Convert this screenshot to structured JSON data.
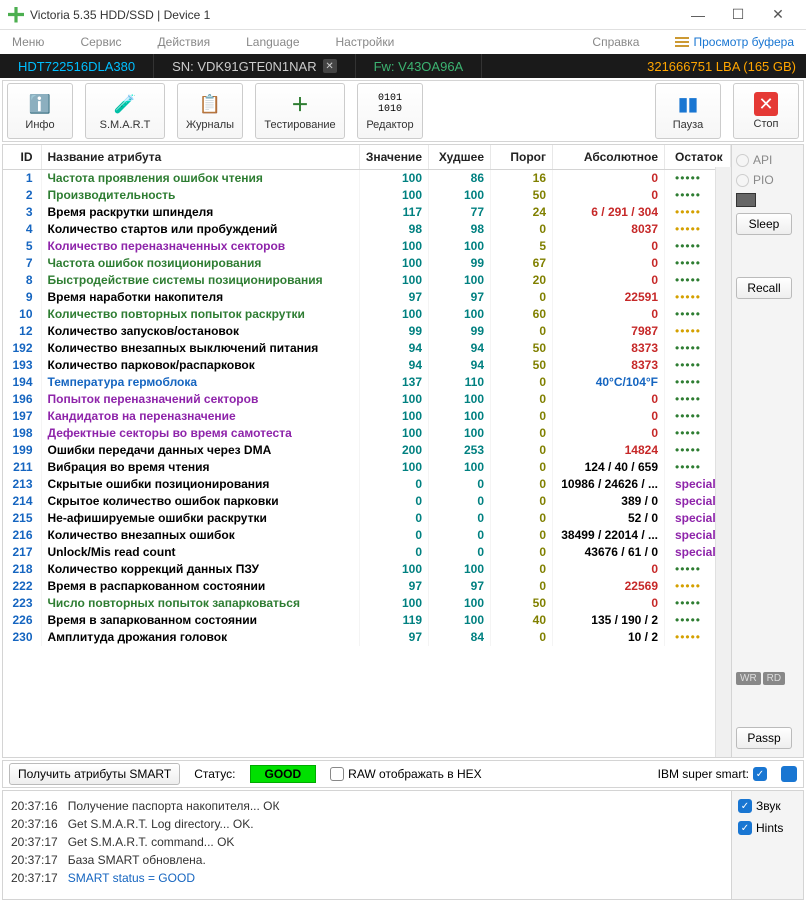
{
  "window": {
    "title": "Victoria 5.35 HDD/SSD | Device 1"
  },
  "menu": {
    "items": [
      "Меню",
      "Сервис",
      "Действия",
      "Language",
      "Настройки"
    ],
    "help": "Справка",
    "buffer": "Просмотр буфера"
  },
  "device": {
    "model": "HDT722516DLA380",
    "sn_label": "SN:",
    "sn": "VDK91GTE0N1NAR",
    "fw_label": "Fw:",
    "fw": "V43OA96A",
    "lba": "321666751 LBA (165 GB)"
  },
  "toolbar": {
    "info": "Инфо",
    "smart": "S.M.A.R.T",
    "journals": "Журналы",
    "testing": "Тестирование",
    "editor": "Редактор",
    "pause": "Пауза",
    "stop": "Стоп"
  },
  "headers": {
    "id": "ID",
    "name": "Название атрибута",
    "value": "Значение",
    "worst": "Худшее",
    "threshold": "Порог",
    "absolute": "Абсолютное",
    "rest": "Остаток"
  },
  "rows": [
    {
      "id": "1",
      "name": "Частота проявления ошибок чтения",
      "nc": "green",
      "val": "100",
      "worst": "86",
      "th": "16",
      "abs": "0",
      "ac": "red",
      "rest": "•••••",
      "rc": "green"
    },
    {
      "id": "2",
      "name": "Производительность",
      "nc": "green",
      "val": "100",
      "worst": "100",
      "th": "50",
      "abs": "0",
      "ac": "red",
      "rest": "•••••",
      "rc": "green"
    },
    {
      "id": "3",
      "name": "Время раскрутки шпинделя",
      "nc": "black",
      "val": "117",
      "worst": "77",
      "th": "24",
      "abs": "6 / 291 / 304",
      "ac": "red",
      "rest": "•••••",
      "rc": "yellow"
    },
    {
      "id": "4",
      "name": "Количество стартов или пробуждений",
      "nc": "black",
      "val": "98",
      "worst": "98",
      "th": "0",
      "abs": "8037",
      "ac": "red",
      "rest": "•••••",
      "rc": "yellow"
    },
    {
      "id": "5",
      "name": "Количество переназначенных секторов",
      "nc": "purple",
      "val": "100",
      "worst": "100",
      "th": "5",
      "abs": "0",
      "ac": "red",
      "rest": "•••••",
      "rc": "green"
    },
    {
      "id": "7",
      "name": "Частота ошибок позиционирования",
      "nc": "green",
      "val": "100",
      "worst": "99",
      "th": "67",
      "abs": "0",
      "ac": "red",
      "rest": "•••••",
      "rc": "green"
    },
    {
      "id": "8",
      "name": "Быстродействие системы позиционирования",
      "nc": "green",
      "val": "100",
      "worst": "100",
      "th": "20",
      "abs": "0",
      "ac": "red",
      "rest": "•••••",
      "rc": "green"
    },
    {
      "id": "9",
      "name": "Время наработки накопителя",
      "nc": "black",
      "val": "97",
      "worst": "97",
      "th": "0",
      "abs": "22591",
      "ac": "red",
      "rest": "•••••",
      "rc": "yellow"
    },
    {
      "id": "10",
      "name": "Количество повторных попыток раскрутки",
      "nc": "green",
      "val": "100",
      "worst": "100",
      "th": "60",
      "abs": "0",
      "ac": "red",
      "rest": "•••••",
      "rc": "green"
    },
    {
      "id": "12",
      "name": "Количество запусков/остановок",
      "nc": "black",
      "val": "99",
      "worst": "99",
      "th": "0",
      "abs": "7987",
      "ac": "red",
      "rest": "•••••",
      "rc": "yellow"
    },
    {
      "id": "192",
      "name": "Количество внезапных выключений питания",
      "nc": "black",
      "val": "94",
      "worst": "94",
      "th": "50",
      "abs": "8373",
      "ac": "red",
      "rest": "•••••",
      "rc": "green"
    },
    {
      "id": "193",
      "name": "Количество парковок/распарковок",
      "nc": "black",
      "val": "94",
      "worst": "94",
      "th": "50",
      "abs": "8373",
      "ac": "red",
      "rest": "•••••",
      "rc": "green"
    },
    {
      "id": "194",
      "name": "Температура гермоблока",
      "nc": "blue",
      "val": "137",
      "worst": "110",
      "th": "0",
      "abs": "40°C/104°F",
      "ac": "blue",
      "rest": "•••••",
      "rc": "green"
    },
    {
      "id": "196",
      "name": "Попыток переназначений секторов",
      "nc": "purple",
      "val": "100",
      "worst": "100",
      "th": "0",
      "abs": "0",
      "ac": "red",
      "rest": "•••••",
      "rc": "green"
    },
    {
      "id": "197",
      "name": "Кандидатов на переназначение",
      "nc": "purple",
      "val": "100",
      "worst": "100",
      "th": "0",
      "abs": "0",
      "ac": "red",
      "rest": "•••••",
      "rc": "green"
    },
    {
      "id": "198",
      "name": "Дефектные секторы во время самотеста",
      "nc": "purple",
      "val": "100",
      "worst": "100",
      "th": "0",
      "abs": "0",
      "ac": "red",
      "rest": "•••••",
      "rc": "green"
    },
    {
      "id": "199",
      "name": "Ошибки передачи данных через DMA",
      "nc": "black",
      "val": "200",
      "worst": "253",
      "th": "0",
      "abs": "14824",
      "ac": "red",
      "rest": "•••••",
      "rc": "green"
    },
    {
      "id": "211",
      "name": "Вибрация во время чтения",
      "nc": "black",
      "val": "100",
      "worst": "100",
      "th": "0",
      "abs": "124 / 40 / 659",
      "ac": "black",
      "rest": "•••••",
      "rc": "green"
    },
    {
      "id": "213",
      "name": "Скрытые ошибки позиционирования",
      "nc": "black",
      "val": "0",
      "worst": "0",
      "th": "0",
      "abs": "10986 / 24626 / ...",
      "ac": "black",
      "rest": "special",
      "rc": "special"
    },
    {
      "id": "214",
      "name": "Скрытое количество ошибок парковки",
      "nc": "black",
      "val": "0",
      "worst": "0",
      "th": "0",
      "abs": "389 / 0",
      "ac": "black",
      "rest": "special",
      "rc": "special"
    },
    {
      "id": "215",
      "name": "Не-афишируемые ошибки раскрутки",
      "nc": "black",
      "val": "0",
      "worst": "0",
      "th": "0",
      "abs": "52 / 0",
      "ac": "black",
      "rest": "special",
      "rc": "special"
    },
    {
      "id": "216",
      "name": "Количество внезапных ошибок",
      "nc": "black",
      "val": "0",
      "worst": "0",
      "th": "0",
      "abs": "38499 / 22014 / ...",
      "ac": "black",
      "rest": "special",
      "rc": "special"
    },
    {
      "id": "217",
      "name": "Unlock/Mis read count",
      "nc": "black",
      "val": "0",
      "worst": "0",
      "th": "0",
      "abs": "43676 / 61 / 0",
      "ac": "black",
      "rest": "special",
      "rc": "special"
    },
    {
      "id": "218",
      "name": "Количество коррекций данных ПЗУ",
      "nc": "black",
      "val": "100",
      "worst": "100",
      "th": "0",
      "abs": "0",
      "ac": "red",
      "rest": "•••••",
      "rc": "green"
    },
    {
      "id": "222",
      "name": "Время в распаркованном состоянии",
      "nc": "black",
      "val": "97",
      "worst": "97",
      "th": "0",
      "abs": "22569",
      "ac": "red",
      "rest": "•••••",
      "rc": "yellow"
    },
    {
      "id": "223",
      "name": "Число повторных попыток запарковаться",
      "nc": "green",
      "val": "100",
      "worst": "100",
      "th": "50",
      "abs": "0",
      "ac": "red",
      "rest": "•••••",
      "rc": "green"
    },
    {
      "id": "226",
      "name": "Время в запаркованном состоянии",
      "nc": "black",
      "val": "119",
      "worst": "100",
      "th": "40",
      "abs": "135 / 190 / 2",
      "ac": "black",
      "rest": "•••••",
      "rc": "green"
    },
    {
      "id": "230",
      "name": "Амплитуда дрожания головок",
      "nc": "black",
      "val": "97",
      "worst": "84",
      "th": "0",
      "abs": "10 / 2",
      "ac": "black",
      "rest": "•••••",
      "rc": "yellow"
    }
  ],
  "side": {
    "api": "API",
    "pio": "PIO",
    "sleep": "Sleep",
    "recall": "Recall",
    "passp": "Passp",
    "wr": "WR",
    "rd": "RD"
  },
  "status": {
    "get": "Получить атрибуты SMART",
    "label": "Статус:",
    "value": "GOOD",
    "raw": "RAW отображать в HEX",
    "ibm": "IBM super smart:"
  },
  "log": [
    {
      "t": "20:37:16",
      "m": "Получение паспорта накопителя... ОК",
      "c": ""
    },
    {
      "t": "20:37:16",
      "m": "Get S.M.A.R.T. Log directory... OK.",
      "c": ""
    },
    {
      "t": "20:37:17",
      "m": "Get S.M.A.R.T. command... OK",
      "c": ""
    },
    {
      "t": "20:37:17",
      "m": "База SMART обновлена.",
      "c": ""
    },
    {
      "t": "20:37:17",
      "m": "SMART status = GOOD",
      "c": "blue"
    }
  ],
  "logside": {
    "sound": "Звук",
    "hints": "Hints"
  }
}
